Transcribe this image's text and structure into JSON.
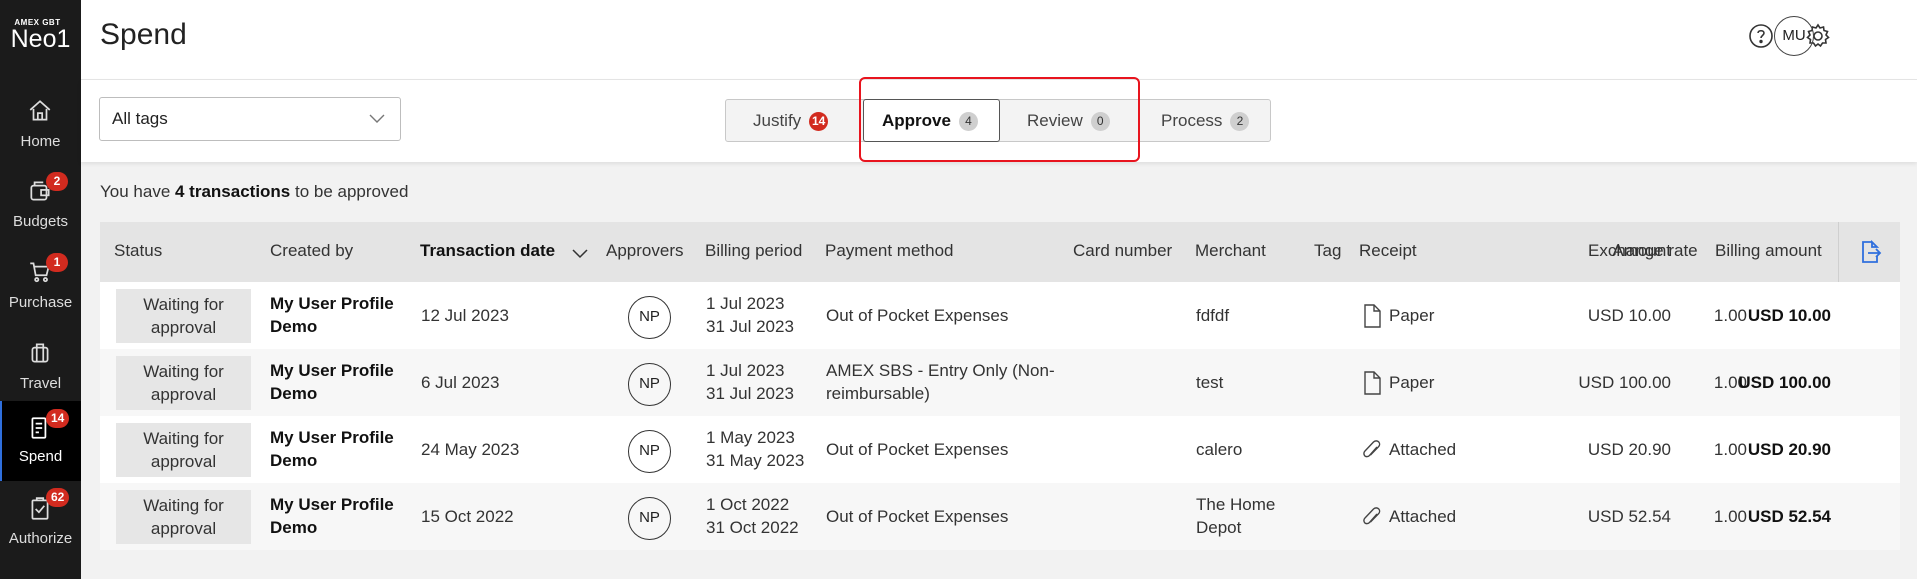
{
  "sidebar": {
    "logo_small": "AMEX GBT",
    "logo_big": "Neo1",
    "items": [
      {
        "label": "Home",
        "badge": ""
      },
      {
        "label": "Budgets",
        "badge": "2"
      },
      {
        "label": "Purchase",
        "badge": "1"
      },
      {
        "label": "Travel",
        "badge": ""
      },
      {
        "label": "Spend",
        "badge": "14"
      },
      {
        "label": "Authorize",
        "badge": "62"
      }
    ]
  },
  "header": {
    "title": "Spend",
    "avatar": "MU"
  },
  "toolbar": {
    "tags_value": "All tags",
    "tabs": [
      {
        "label": "Justify",
        "count": "14"
      },
      {
        "label": "Approve",
        "count": "4"
      },
      {
        "label": "Review",
        "count": "0"
      },
      {
        "label": "Process",
        "count": "2"
      }
    ]
  },
  "summary": {
    "prefix": "You have ",
    "count": "4 transactions",
    "suffix": " to be approved"
  },
  "table": {
    "columns": {
      "status": "Status",
      "created_by": "Created by",
      "transaction_date": "Transaction date",
      "approvers": "Approvers",
      "billing_period": "Billing period",
      "payment_method": "Payment method",
      "card_number": "Card number",
      "merchant": "Merchant",
      "tag": "Tag",
      "receipt": "Receipt",
      "amount": "Amount",
      "exchange_rate": "Exchange rate",
      "billing_amount": "Billing amount"
    },
    "rows": [
      {
        "status_1": "Waiting for",
        "status_2": "approval",
        "creator_1": "My User Profile",
        "creator_2": "Demo",
        "date": "12 Jul 2023",
        "approver": "NP",
        "period_start": "1 Jul 2023",
        "period_end": "31 Jul 2023",
        "payment_1": "Out of Pocket Expenses",
        "payment_2": "",
        "merchant_1": "fdfdf",
        "merchant_2": "",
        "receipt": "Paper",
        "receipt_icon": "document-icon",
        "amount": "USD 10.00",
        "rate": "1.00",
        "billing": "USD 10.00"
      },
      {
        "status_1": "Waiting for",
        "status_2": "approval",
        "creator_1": "My User Profile",
        "creator_2": "Demo",
        "date": "6 Jul 2023",
        "approver": "NP",
        "period_start": "1 Jul 2023",
        "period_end": "31 Jul 2023",
        "payment_1": "AMEX SBS - Entry Only (Non-",
        "payment_2": "reimbursable)",
        "merchant_1": "test",
        "merchant_2": "",
        "receipt": "Paper",
        "receipt_icon": "document-icon",
        "amount": "USD 100.00",
        "rate": "1.00",
        "billing": "USD 100.00"
      },
      {
        "status_1": "Waiting for",
        "status_2": "approval",
        "creator_1": "My User Profile",
        "creator_2": "Demo",
        "date": "24 May 2023",
        "approver": "NP",
        "period_start": "1 May 2023",
        "period_end": "31 May 2023",
        "payment_1": "Out of Pocket Expenses",
        "payment_2": "",
        "merchant_1": "calero",
        "merchant_2": "",
        "receipt": "Attached",
        "receipt_icon": "paperclip-icon",
        "amount": "USD 20.90",
        "rate": "1.00",
        "billing": "USD 20.90"
      },
      {
        "status_1": "Waiting for",
        "status_2": "approval",
        "creator_1": "My User Profile",
        "creator_2": "Demo",
        "date": "15 Oct 2022",
        "approver": "NP",
        "period_start": "1 Oct 2022",
        "period_end": "31 Oct 2022",
        "payment_1": "Out of Pocket Expenses",
        "payment_2": "",
        "merchant_1": "The Home",
        "merchant_2": "Depot",
        "receipt": "Attached",
        "receipt_icon": "paperclip-icon",
        "amount": "USD 52.54",
        "rate": "1.00",
        "billing": "USD 52.54"
      }
    ]
  },
  "colors": {
    "sidebar_bg": "#1b1b1b",
    "badge_red": "#d22b1f",
    "highlight_red": "#e8141e",
    "accent_blue": "#2f6fdd"
  }
}
